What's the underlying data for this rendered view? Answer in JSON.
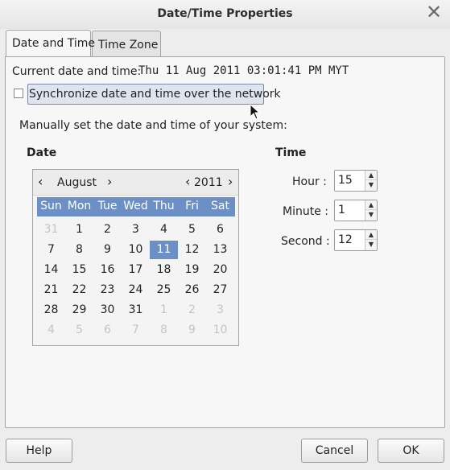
{
  "window": {
    "title": "Date/Time Properties",
    "close_glyph": "✕"
  },
  "tabs": [
    {
      "label": "Date and Time",
      "active": true
    },
    {
      "label": "Time Zone",
      "active": false
    }
  ],
  "current": {
    "label": "Current date and time:",
    "value": "Thu 11 Aug 2011 03:01:41 PM MYT"
  },
  "sync": {
    "label": "Synchronize date and time over the network",
    "checked": false
  },
  "manual_label": "Manually set the date and time of your system:",
  "date_section": {
    "heading": "Date",
    "month": "August",
    "year": "2011",
    "prev_glyph": "‹",
    "next_glyph": "›",
    "day_names": [
      "Sun",
      "Mon",
      "Tue",
      "Wed",
      "Thu",
      "Fri",
      "Sat"
    ],
    "weeks": [
      [
        "31",
        "1",
        "2",
        "3",
        "4",
        "5",
        "6"
      ],
      [
        "7",
        "8",
        "9",
        "10",
        "11",
        "12",
        "13"
      ],
      [
        "14",
        "15",
        "16",
        "17",
        "18",
        "19",
        "20"
      ],
      [
        "21",
        "22",
        "23",
        "24",
        "25",
        "26",
        "27"
      ],
      [
        "28",
        "29",
        "30",
        "31",
        "1",
        "2",
        "3"
      ],
      [
        "4",
        "5",
        "6",
        "7",
        "8",
        "9",
        "10"
      ]
    ],
    "selected_day": "11"
  },
  "time_section": {
    "heading": "Time",
    "hour_label": "Hour :",
    "hour": "15",
    "minute_label": "Minute :",
    "minute": "1",
    "second_label": "Second :",
    "second": "12"
  },
  "buttons": {
    "help": "Help",
    "cancel": "Cancel",
    "ok": "OK"
  },
  "colors": {
    "selection": "#6c8fc6",
    "sync_highlight": "#dfe5ef"
  },
  "icons": {
    "close": "close-icon",
    "pointer": "mouse-pointer-icon"
  }
}
